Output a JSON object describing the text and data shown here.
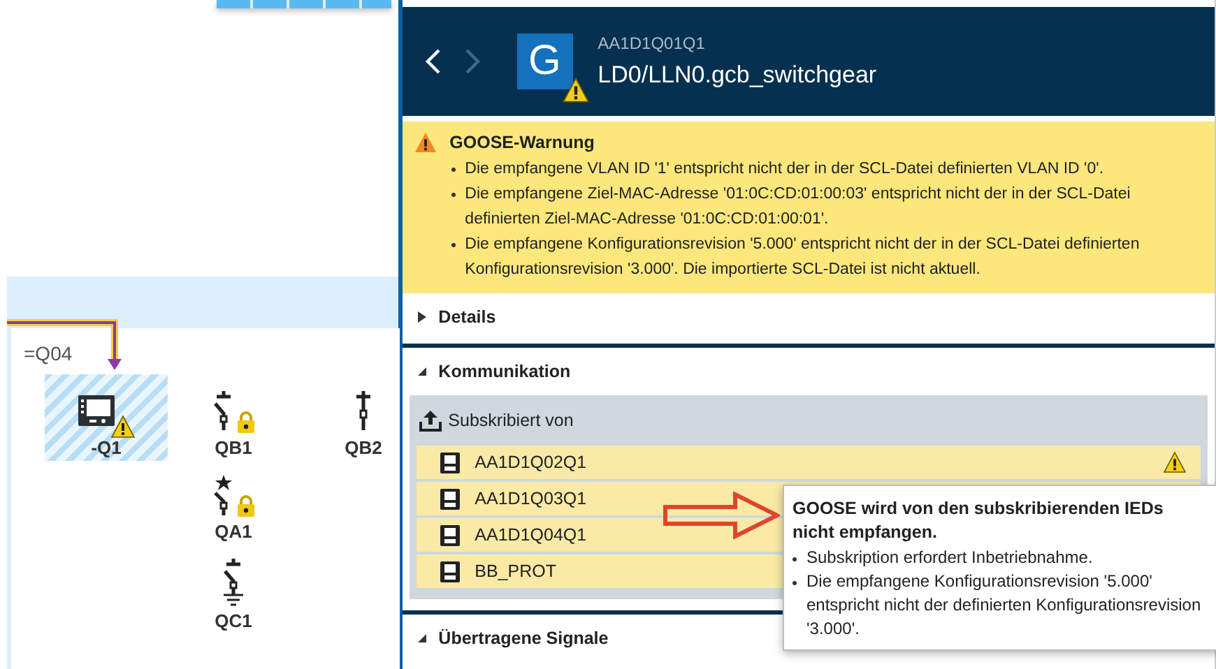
{
  "diagram": {
    "bay_label": "=Q04",
    "devices": [
      {
        "label": "-Q1",
        "kind": "ied",
        "selected": true,
        "warning": true,
        "locked": false
      },
      {
        "label": "QB1",
        "kind": "disconnector",
        "selected": false,
        "warning": false,
        "locked": true
      },
      {
        "label": "QB2",
        "kind": "switch",
        "selected": false,
        "warning": false,
        "locked": false
      },
      {
        "label": "QA1",
        "kind": "breaker",
        "selected": false,
        "warning": false,
        "locked": true
      },
      {
        "label": "QC1",
        "kind": "earthing",
        "selected": false,
        "warning": false,
        "locked": false
      }
    ]
  },
  "header": {
    "subtitle": "AA1D1Q01Q1",
    "title": "LD0/LLN0.gcb_switchgear",
    "icon_letter": "G",
    "warning": true,
    "back_disabled": false,
    "forward_disabled": true
  },
  "warning_box": {
    "title": "GOOSE-Warnung",
    "items": [
      "Die empfangene VLAN ID '1' entspricht nicht der in der SCL-Datei definierten VLAN ID '0'.",
      "Die empfangene Ziel-MAC-Adresse '01:0C:CD:01:00:03' entspricht nicht der in der SCL-Datei definierten Ziel-MAC-Adresse '01:0C:CD:01:00:01'.",
      "Die empfangene Konfigurationsrevision '5.000' entspricht nicht der in der SCL-Datei definierten Konfigurationsrevision '3.000'. Die importierte SCL-Datei ist nicht aktuell."
    ]
  },
  "sections": [
    {
      "title": "Details",
      "expanded": false
    },
    {
      "title": "Kommunikation",
      "expanded": true,
      "group": {
        "title": "Subskribiert von",
        "rows": [
          {
            "name": "AA1D1Q02Q1",
            "warning": true
          },
          {
            "name": "AA1D1Q03Q1"
          },
          {
            "name": "AA1D1Q04Q1"
          },
          {
            "name": "BB_PROT"
          }
        ]
      }
    },
    {
      "title": "Übertragene Signale",
      "expanded": true
    }
  ],
  "tooltip": {
    "title": "GOOSE wird von den subskribierenden IEDs nicht empfangen.",
    "items": [
      "Subskription erfordert Inbetriebnahme.",
      "Die empfangene Konfigurationsrevision '5.000' entspricht nicht der definierten Konfigurationsrevision '3.000'."
    ]
  }
}
